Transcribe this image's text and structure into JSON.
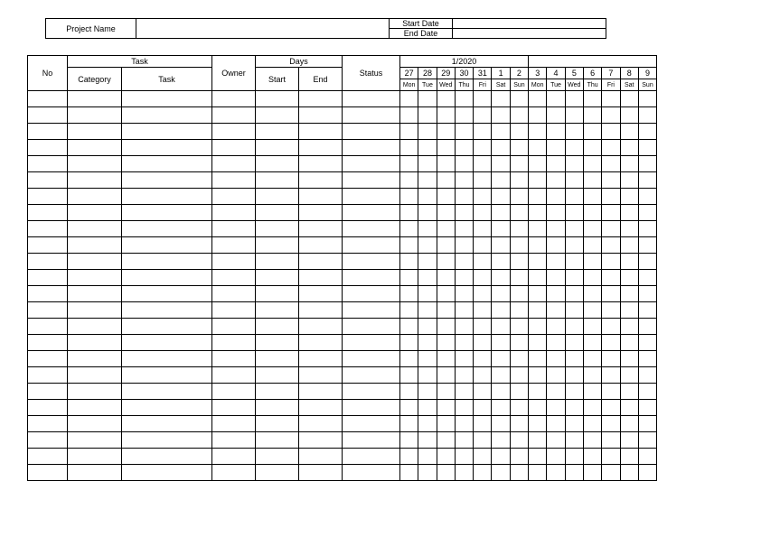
{
  "info": {
    "project_name_label": "Project Name",
    "start_date_label": "Start Date",
    "end_date_label": "End Date",
    "project_name_value": "",
    "start_date_value": "",
    "end_date_value": ""
  },
  "headers": {
    "no": "No",
    "task_group": "Task",
    "category": "Category",
    "task": "Task",
    "owner": "Owner",
    "days_group": "Days",
    "start": "Start",
    "end": "End",
    "status": "Status",
    "month": "1/2020"
  },
  "days": [
    {
      "num": "27",
      "dow": "Mon"
    },
    {
      "num": "28",
      "dow": "Tue"
    },
    {
      "num": "29",
      "dow": "Wed"
    },
    {
      "num": "30",
      "dow": "Thu"
    },
    {
      "num": "31",
      "dow": "Fri"
    },
    {
      "num": "1",
      "dow": "Sat"
    },
    {
      "num": "2",
      "dow": "Sun"
    },
    {
      "num": "3",
      "dow": "Mon"
    },
    {
      "num": "4",
      "dow": "Tue"
    },
    {
      "num": "5",
      "dow": "Wed"
    },
    {
      "num": "6",
      "dow": "Thu"
    },
    {
      "num": "7",
      "dow": "Fri"
    },
    {
      "num": "8",
      "dow": "Sat"
    },
    {
      "num": "9",
      "dow": "Sun"
    }
  ],
  "row_count": 24
}
